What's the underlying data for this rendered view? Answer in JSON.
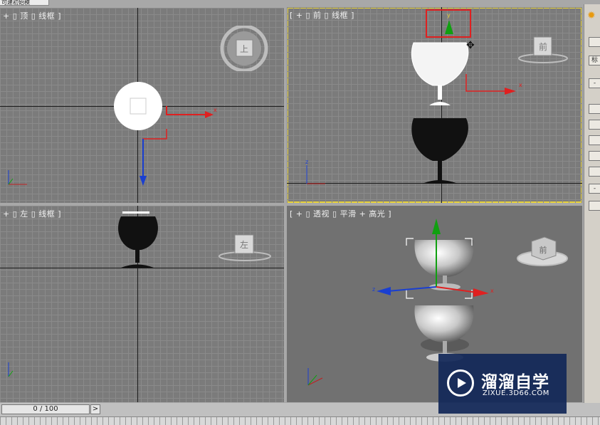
{
  "window": {
    "tab_label": "可建初始模"
  },
  "viewports": {
    "top": {
      "label": "+ ▯ 顶 ▯ 线框 ]",
      "navcube_label": "上",
      "axis_x": "x"
    },
    "front": {
      "label": "[ + ▯ 前 ▯ 线框 ]",
      "navcube_label": "前",
      "axis_x": "x",
      "axis_y": "y",
      "axis_z": "z"
    },
    "left": {
      "label": "+ ▯ 左 ▯ 线框 ]",
      "navcube_label": "左"
    },
    "perspective": {
      "label": "[ + ▯ 透视 ▯ 平滑 + 高光 ]",
      "navcube_label": "前",
      "axis_x": "x",
      "axis_z": "z"
    }
  },
  "timeline": {
    "frame_counter": "0 / 100",
    "next_button": ">"
  },
  "watermark": {
    "title": "溜溜自学",
    "subtitle": "ZIXUE.3D66.COM"
  },
  "sidebar": {
    "label_char": "标"
  },
  "colors": {
    "viewport_bg": "#7b7b7b",
    "active_border": "#e8d23a",
    "axis_x": "#e02020",
    "axis_y": "#10a010",
    "axis_z": "#1a3fd0"
  }
}
